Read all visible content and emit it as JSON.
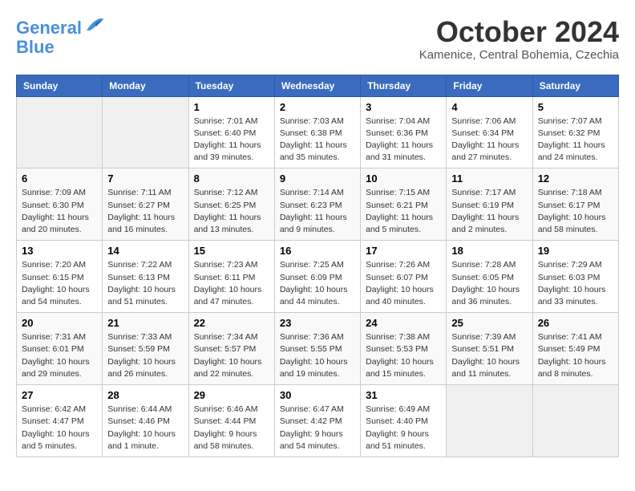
{
  "header": {
    "logo_line1": "General",
    "logo_line2": "Blue",
    "month": "October 2024",
    "location": "Kamenice, Central Bohemia, Czechia"
  },
  "weekdays": [
    "Sunday",
    "Monday",
    "Tuesday",
    "Wednesday",
    "Thursday",
    "Friday",
    "Saturday"
  ],
  "weeks": [
    [
      {
        "day": "",
        "info": ""
      },
      {
        "day": "",
        "info": ""
      },
      {
        "day": "1",
        "info": "Sunrise: 7:01 AM\nSunset: 6:40 PM\nDaylight: 11 hours and 39 minutes."
      },
      {
        "day": "2",
        "info": "Sunrise: 7:03 AM\nSunset: 6:38 PM\nDaylight: 11 hours and 35 minutes."
      },
      {
        "day": "3",
        "info": "Sunrise: 7:04 AM\nSunset: 6:36 PM\nDaylight: 11 hours and 31 minutes."
      },
      {
        "day": "4",
        "info": "Sunrise: 7:06 AM\nSunset: 6:34 PM\nDaylight: 11 hours and 27 minutes."
      },
      {
        "day": "5",
        "info": "Sunrise: 7:07 AM\nSunset: 6:32 PM\nDaylight: 11 hours and 24 minutes."
      }
    ],
    [
      {
        "day": "6",
        "info": "Sunrise: 7:09 AM\nSunset: 6:30 PM\nDaylight: 11 hours and 20 minutes."
      },
      {
        "day": "7",
        "info": "Sunrise: 7:11 AM\nSunset: 6:27 PM\nDaylight: 11 hours and 16 minutes."
      },
      {
        "day": "8",
        "info": "Sunrise: 7:12 AM\nSunset: 6:25 PM\nDaylight: 11 hours and 13 minutes."
      },
      {
        "day": "9",
        "info": "Sunrise: 7:14 AM\nSunset: 6:23 PM\nDaylight: 11 hours and 9 minutes."
      },
      {
        "day": "10",
        "info": "Sunrise: 7:15 AM\nSunset: 6:21 PM\nDaylight: 11 hours and 5 minutes."
      },
      {
        "day": "11",
        "info": "Sunrise: 7:17 AM\nSunset: 6:19 PM\nDaylight: 11 hours and 2 minutes."
      },
      {
        "day": "12",
        "info": "Sunrise: 7:18 AM\nSunset: 6:17 PM\nDaylight: 10 hours and 58 minutes."
      }
    ],
    [
      {
        "day": "13",
        "info": "Sunrise: 7:20 AM\nSunset: 6:15 PM\nDaylight: 10 hours and 54 minutes."
      },
      {
        "day": "14",
        "info": "Sunrise: 7:22 AM\nSunset: 6:13 PM\nDaylight: 10 hours and 51 minutes."
      },
      {
        "day": "15",
        "info": "Sunrise: 7:23 AM\nSunset: 6:11 PM\nDaylight: 10 hours and 47 minutes."
      },
      {
        "day": "16",
        "info": "Sunrise: 7:25 AM\nSunset: 6:09 PM\nDaylight: 10 hours and 44 minutes."
      },
      {
        "day": "17",
        "info": "Sunrise: 7:26 AM\nSunset: 6:07 PM\nDaylight: 10 hours and 40 minutes."
      },
      {
        "day": "18",
        "info": "Sunrise: 7:28 AM\nSunset: 6:05 PM\nDaylight: 10 hours and 36 minutes."
      },
      {
        "day": "19",
        "info": "Sunrise: 7:29 AM\nSunset: 6:03 PM\nDaylight: 10 hours and 33 minutes."
      }
    ],
    [
      {
        "day": "20",
        "info": "Sunrise: 7:31 AM\nSunset: 6:01 PM\nDaylight: 10 hours and 29 minutes."
      },
      {
        "day": "21",
        "info": "Sunrise: 7:33 AM\nSunset: 5:59 PM\nDaylight: 10 hours and 26 minutes."
      },
      {
        "day": "22",
        "info": "Sunrise: 7:34 AM\nSunset: 5:57 PM\nDaylight: 10 hours and 22 minutes."
      },
      {
        "day": "23",
        "info": "Sunrise: 7:36 AM\nSunset: 5:55 PM\nDaylight: 10 hours and 19 minutes."
      },
      {
        "day": "24",
        "info": "Sunrise: 7:38 AM\nSunset: 5:53 PM\nDaylight: 10 hours and 15 minutes."
      },
      {
        "day": "25",
        "info": "Sunrise: 7:39 AM\nSunset: 5:51 PM\nDaylight: 10 hours and 11 minutes."
      },
      {
        "day": "26",
        "info": "Sunrise: 7:41 AM\nSunset: 5:49 PM\nDaylight: 10 hours and 8 minutes."
      }
    ],
    [
      {
        "day": "27",
        "info": "Sunrise: 6:42 AM\nSunset: 4:47 PM\nDaylight: 10 hours and 5 minutes."
      },
      {
        "day": "28",
        "info": "Sunrise: 6:44 AM\nSunset: 4:46 PM\nDaylight: 10 hours and 1 minute."
      },
      {
        "day": "29",
        "info": "Sunrise: 6:46 AM\nSunset: 4:44 PM\nDaylight: 9 hours and 58 minutes."
      },
      {
        "day": "30",
        "info": "Sunrise: 6:47 AM\nSunset: 4:42 PM\nDaylight: 9 hours and 54 minutes."
      },
      {
        "day": "31",
        "info": "Sunrise: 6:49 AM\nSunset: 4:40 PM\nDaylight: 9 hours and 51 minutes."
      },
      {
        "day": "",
        "info": ""
      },
      {
        "day": "",
        "info": ""
      }
    ]
  ]
}
